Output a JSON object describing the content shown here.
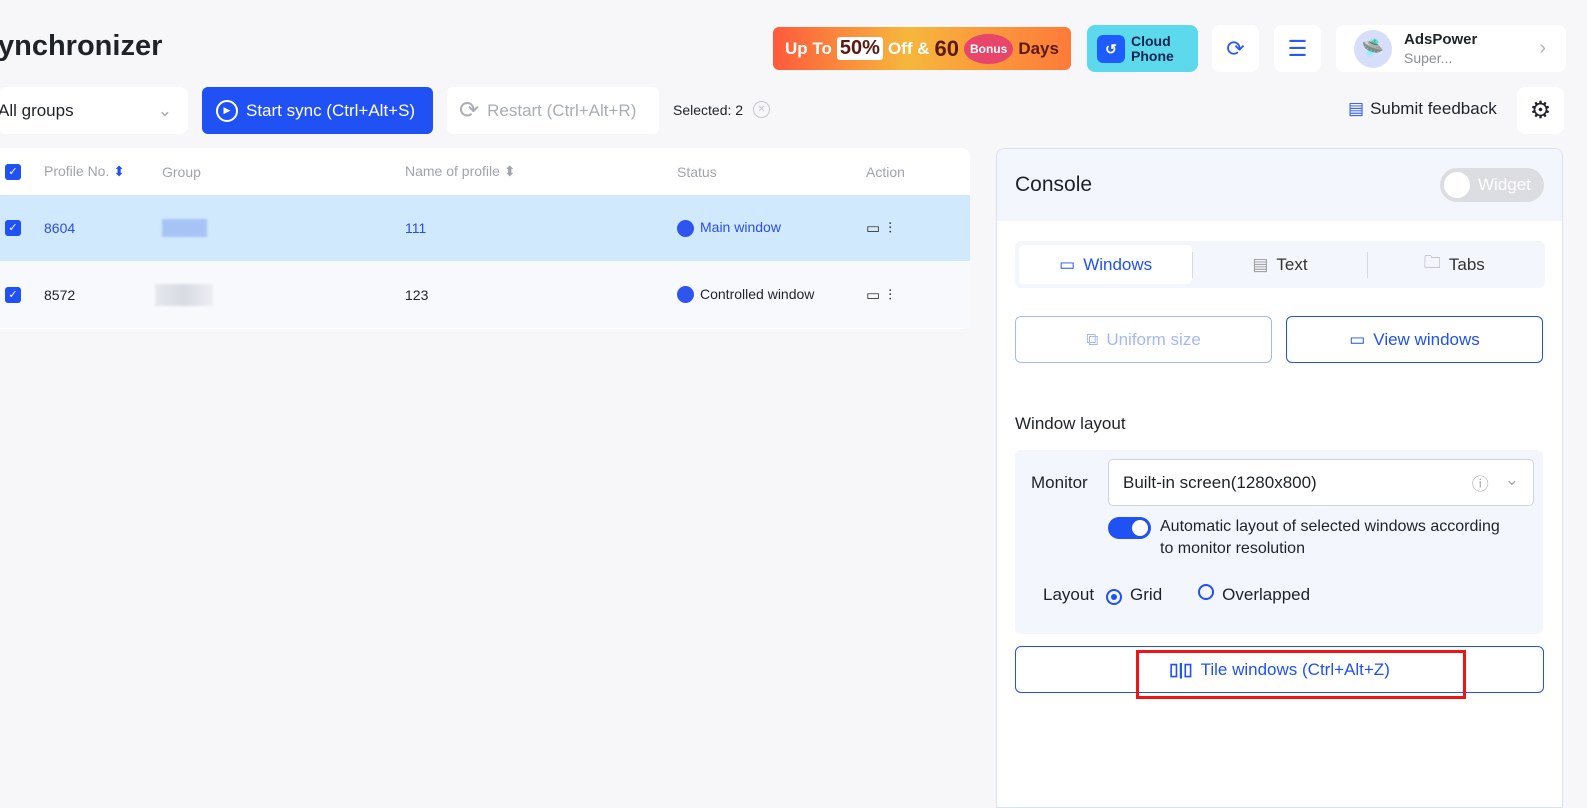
{
  "header": {
    "title": "ynchronizer",
    "promo": {
      "text1": "Up To",
      "pct": "50%",
      "off": "Off &",
      "num": "60",
      "bonus": "Bonus",
      "days": "Days"
    },
    "cloud_phone": "Cloud Phone",
    "user": {
      "name": "AdsPower",
      "role": "Super..."
    }
  },
  "toolbar": {
    "group_select": "All groups",
    "start_sync": "Start sync (Ctrl+Alt+S)",
    "restart": "Restart (Ctrl+Alt+R)",
    "selected": "Selected: 2",
    "submit_feedback": "Submit feedback"
  },
  "table": {
    "columns": [
      "Profile No.",
      "Group",
      "Name of profile",
      "Status",
      "Action"
    ],
    "rows": [
      {
        "profile_no": "8604",
        "name": "111",
        "status": "Main window",
        "selected": true
      },
      {
        "profile_no": "8572",
        "name": "123",
        "status": "Controlled window",
        "selected": true
      }
    ]
  },
  "console": {
    "title": "Console",
    "widget": "Widget",
    "widget_on": false,
    "tabs": [
      "Windows",
      "Text",
      "Tabs"
    ],
    "active_tab": "Windows",
    "uniform_size": "Uniform size",
    "view_windows": "View windows",
    "window_layout": "Window layout",
    "monitor_label": "Monitor",
    "monitor_value": "Built-in screen(1280x800)",
    "auto_layout": "Automatic layout of selected windows according to monitor resolution",
    "auto_layout_on": true,
    "layout_label": "Layout",
    "layout_options": [
      "Grid",
      "Overlapped"
    ],
    "layout_selected": "Grid",
    "tile_windows": "Tile windows (Ctrl+Alt+Z)"
  },
  "colors": {
    "accent": "#2051f5",
    "highlight": "#f01414",
    "selected_row": "#d1e9fc"
  }
}
